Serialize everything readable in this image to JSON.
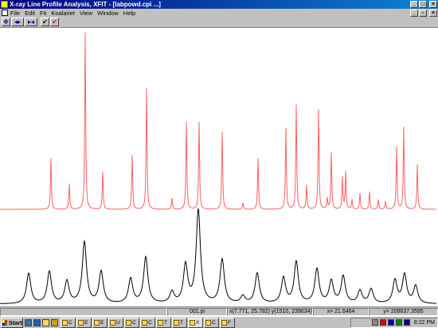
{
  "window": {
    "title": "X-ray Line Profile Analysis, XFIT  - [labpowd.cpi ...]",
    "controls": {
      "minimize": "_",
      "maximize": "□",
      "close": "×"
    },
    "doc_controls": {
      "minimize": "_",
      "restore": "▫",
      "close": "×"
    }
  },
  "menu": {
    "items": [
      {
        "key": "file",
        "label": "File"
      },
      {
        "key": "edit",
        "label": "Edit"
      },
      {
        "key": "fit",
        "label": "Fit"
      },
      {
        "key": "koalariet",
        "label": "Koalariet"
      },
      {
        "key": "view",
        "label": "View"
      },
      {
        "key": "window",
        "label": "Window"
      },
      {
        "key": "help",
        "label": "Help"
      }
    ]
  },
  "toolbar": {
    "buttons": [
      {
        "name": "move-icon",
        "glyph": "✥",
        "color": "#0000a0"
      },
      {
        "name": "expand-horizontal-icon",
        "glyph": "◂▸",
        "color": "#0000a0"
      },
      {
        "name": "contract-horizontal-icon",
        "glyph": "▸◂",
        "color": "#0000a0"
      },
      {
        "name": "accept-check-icon",
        "glyph": "✔",
        "color": "#000000"
      },
      {
        "name": "fit-check-icon",
        "glyph": "✔",
        "color": "#d00000"
      }
    ]
  },
  "colors": {
    "calculated_pattern": "#ff6060",
    "observed_pattern": "#000000",
    "title_bar_start": "#000080",
    "title_bar_end": "#1084d0"
  },
  "chart_data": {
    "type": "line",
    "grid": false,
    "legend": "none",
    "xlim": [
      0,
      550
    ],
    "series": [
      {
        "peaks": [
          {
            "x": 64,
            "h": 64
          },
          {
            "x": 87,
            "h": 32
          },
          {
            "x": 107,
            "h": 222
          },
          {
            "x": 129,
            "h": 47
          },
          {
            "x": 166,
            "h": 68
          },
          {
            "x": 184,
            "h": 152
          },
          {
            "x": 216,
            "h": 14
          },
          {
            "x": 234,
            "h": 110
          },
          {
            "x": 250,
            "h": 110
          },
          {
            "x": 279,
            "h": 97
          },
          {
            "x": 305,
            "h": 8
          },
          {
            "x": 324,
            "h": 64
          },
          {
            "x": 359,
            "h": 102
          },
          {
            "x": 372,
            "h": 131
          },
          {
            "x": 385,
            "h": 30
          },
          {
            "x": 400,
            "h": 125
          },
          {
            "x": 411,
            "h": 14
          },
          {
            "x": 416,
            "h": 71
          },
          {
            "x": 430,
            "h": 40
          },
          {
            "x": 434,
            "h": 47
          },
          {
            "x": 442,
            "h": 12
          },
          {
            "x": 452,
            "h": 20
          },
          {
            "x": 464,
            "h": 22
          },
          {
            "x": 475,
            "h": 12
          },
          {
            "x": 484,
            "h": 10
          },
          {
            "x": 498,
            "h": 78
          },
          {
            "x": 507,
            "h": 103
          },
          {
            "x": 524,
            "h": 56
          }
        ]
      },
      {
        "peaks": [
          {
            "x": 36,
            "h": 38
          },
          {
            "x": 62,
            "h": 40
          },
          {
            "x": 84,
            "h": 28
          },
          {
            "x": 106,
            "h": 77
          },
          {
            "x": 127,
            "h": 40
          },
          {
            "x": 164,
            "h": 31
          },
          {
            "x": 183,
            "h": 58
          },
          {
            "x": 216,
            "h": 14
          },
          {
            "x": 233,
            "h": 48
          },
          {
            "x": 249,
            "h": 117
          },
          {
            "x": 279,
            "h": 55
          },
          {
            "x": 305,
            "h": 9
          },
          {
            "x": 323,
            "h": 38
          },
          {
            "x": 356,
            "h": 32
          },
          {
            "x": 372,
            "h": 52
          },
          {
            "x": 398,
            "h": 43
          },
          {
            "x": 416,
            "h": 28
          },
          {
            "x": 431,
            "h": 34
          },
          {
            "x": 452,
            "h": 16
          },
          {
            "x": 466,
            "h": 18
          },
          {
            "x": 496,
            "h": 29
          },
          {
            "x": 508,
            "h": 36
          },
          {
            "x": 522,
            "h": 22
          }
        ]
      }
    ]
  },
  "status": {
    "file": "001.pi",
    "coords": "x(7.771, 25.782) y(1510, 239634)",
    "x_readout": "x= 21.6464",
    "y_readout": "y= 208637.3595"
  },
  "taskbar": {
    "start_label": "Start",
    "tasks": [
      {
        "label": "C"
      },
      {
        "label": "E"
      },
      {
        "label": "E"
      },
      {
        "label": "U"
      },
      {
        "label": "C"
      },
      {
        "label": "C"
      },
      {
        "label": "T"
      },
      {
        "label": "T"
      },
      {
        "label": "X"
      },
      {
        "label": "C"
      },
      {
        "label": "F"
      }
    ],
    "clock": "8:22 PM"
  }
}
